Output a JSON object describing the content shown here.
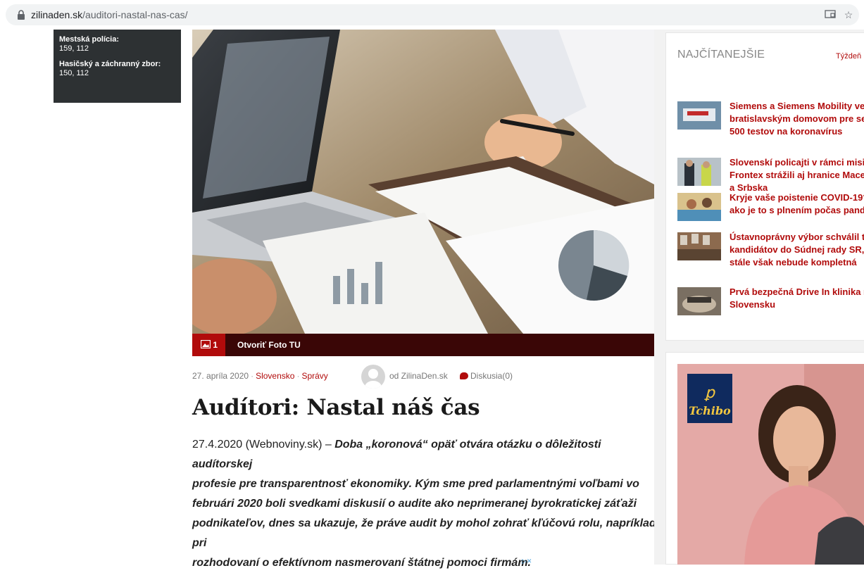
{
  "browser": {
    "url_host": "zilinaden.sk",
    "url_path": "/auditori-nastal-nas-cas/"
  },
  "emergency": [
    {
      "label": "Mestská polícia:",
      "value": "159, 112"
    },
    {
      "label": "Hasičský a záchranný zbor:",
      "value": "150, 112"
    }
  ],
  "photo": {
    "count": "1",
    "link": "Otvoriť Foto TU"
  },
  "meta": {
    "date": "27. apríla 2020",
    "category1": "Slovensko",
    "category2": "Správy",
    "author": "od ZilinaDen.sk",
    "discussion": "Diskusia(0)"
  },
  "article": {
    "title": "Audítori: Nastal náš čas",
    "lead_source": "27.4.2020 (Webnoviny.sk) – ",
    "lead_lines": [
      "Doba „koronová“ opäť otvára otázku o dôležitosti audítorskej",
      "profesie pre transparentnosť ekonomiky. Kým sme pred parlamentnými voľbami vo",
      "februári 2020 boli svedkami diskusií o audite ako neprimeranej byrokratickej záťaži",
      "podnikateľov, dnes sa ukazuje, že práve audit by mohol zohrať kľúčovú rolu, napríklad pri",
      "rozhodovaní o efektívnom nasmerovaní štátnej pomoci firmám."
    ]
  },
  "sidebar": {
    "heading": "NAJČÍTANEJŠIE",
    "tab": "Týždeň",
    "items": [
      {
        "l1": "Siemens a Siemens Mobility ve",
        "l2": "bratislavským domovom pre se",
        "l3": "500 testov na koronavírus"
      },
      {
        "l1": "Slovenskí policajti v rámci misi",
        "l2": "Frontex strážili aj hranice Mace",
        "l3": "a Srbska"
      },
      {
        "l1": "Kryje vaše poistenie COVID-19?",
        "l2": "ako je to s plnením počas pande",
        "l3": ""
      },
      {
        "l1": "Ústavnoprávny výbor schválil tr",
        "l2": "kandidátov do Súdnej rady SR, a",
        "l3": "stále však nebude kompletná"
      },
      {
        "l1": "Prvá bezpečná Drive In klinika n",
        "l2": "Slovensku",
        "l3": ""
      }
    ]
  },
  "ad": {
    "brand": "Tchibo"
  },
  "colors": {
    "accent": "#b10b0b",
    "dark_box": "#2d3133",
    "photo_bar": "#3a0606"
  }
}
